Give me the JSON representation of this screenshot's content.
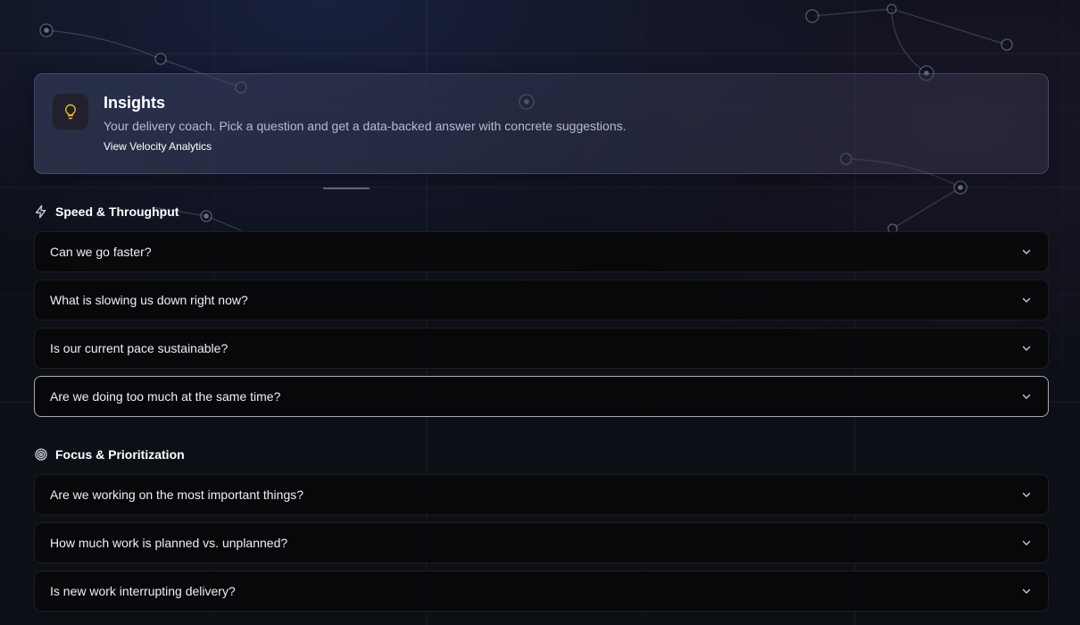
{
  "hero": {
    "title": "Insights",
    "subtitle": "Your delivery coach. Pick a question and get a data-backed answer with concrete suggestions.",
    "link": "View Velocity Analytics",
    "icon": "lightbulb-icon",
    "icon_color": "#f0b429"
  },
  "sections": [
    {
      "title": "Speed & Throughput",
      "icon": "lightning-icon",
      "questions": [
        "Can we go faster?",
        "What is slowing us down right now?",
        "Is our current pace sustainable?",
        "Are we doing too much at the same time?"
      ]
    },
    {
      "title": "Focus & Prioritization",
      "icon": "target-icon",
      "questions": [
        "Are we working on the most important things?",
        "How much work is planned vs. unplanned?",
        "Is new work interrupting delivery?"
      ]
    }
  ]
}
